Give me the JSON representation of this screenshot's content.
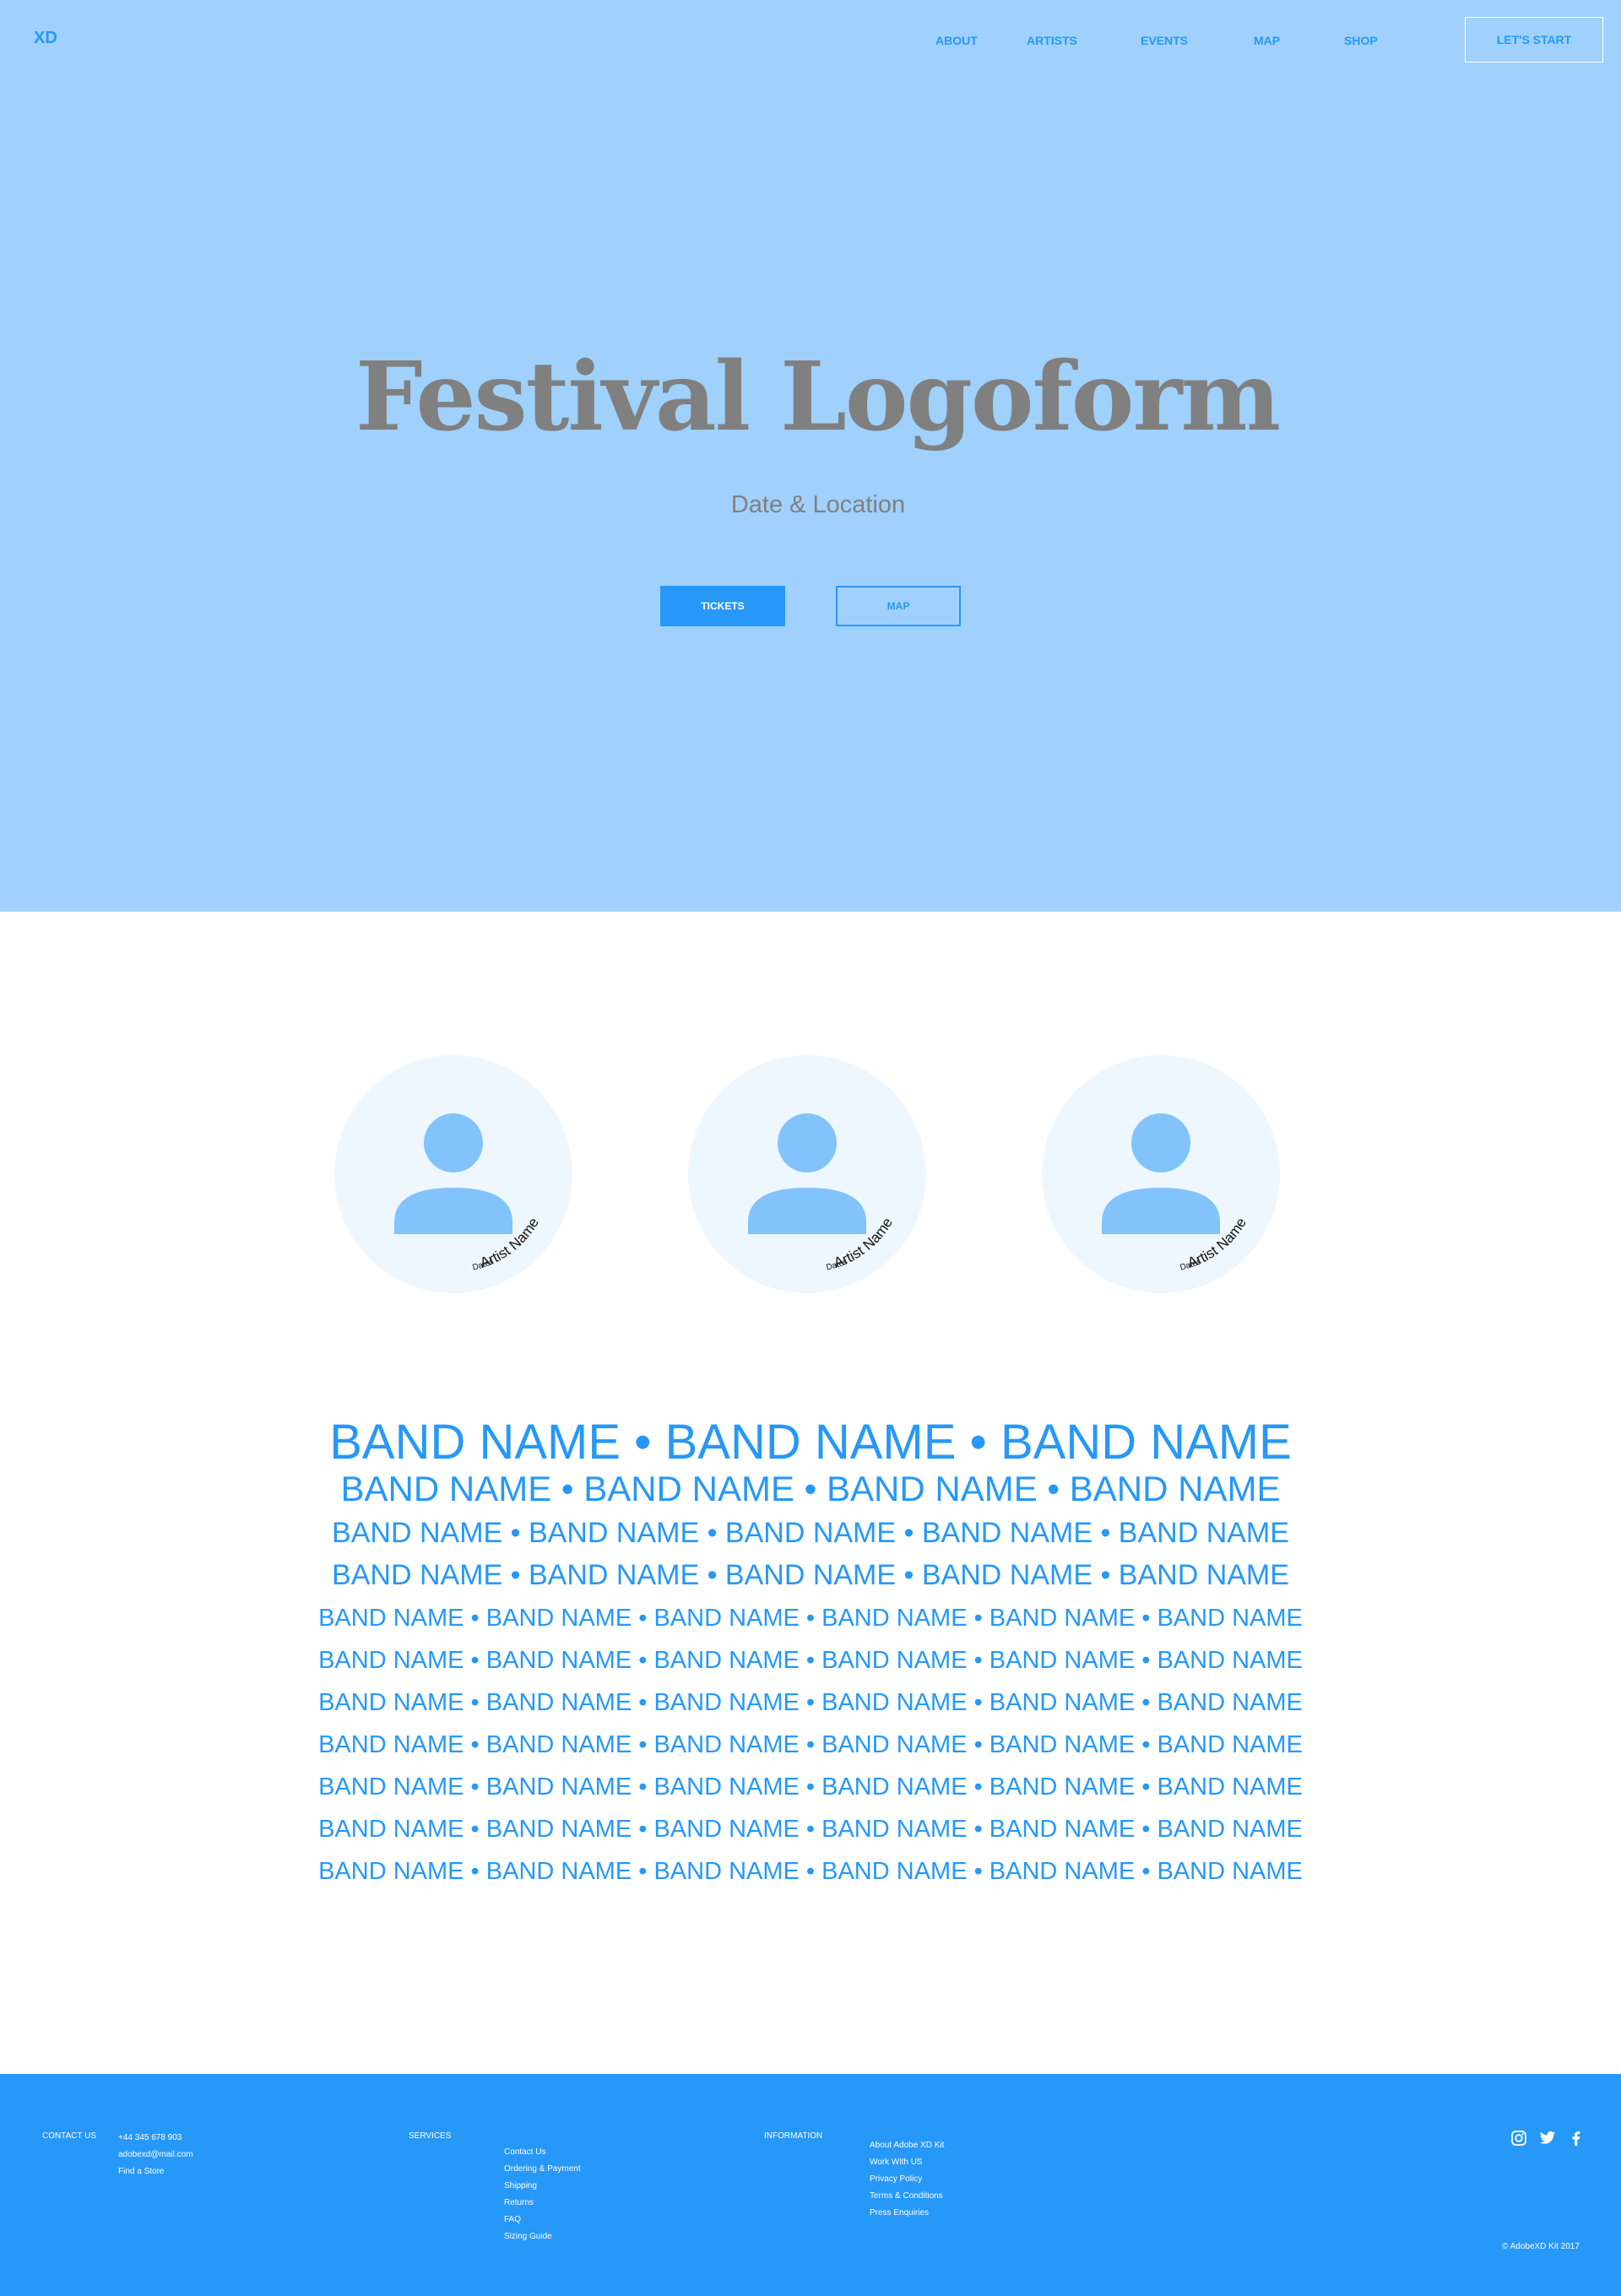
{
  "header": {
    "logo": "XD",
    "nav": [
      "ABOUT",
      "ARTISTS",
      "EVENTS",
      "MAP",
      "SHOP"
    ],
    "cta": "LET'S START"
  },
  "hero": {
    "title": "Festival Logoform",
    "subtitle": "Date & Location",
    "primary_button": "TICKETS",
    "secondary_button": "MAP"
  },
  "artists": [
    {
      "name": "Artist Name",
      "dates": "Dates"
    },
    {
      "name": "Artist Name",
      "dates": "Dates"
    },
    {
      "name": "Artist Name",
      "dates": "Dates"
    }
  ],
  "lineup": [
    "BAND NAME • BAND NAME • BAND NAME",
    "BAND NAME • BAND NAME • BAND NAME • BAND NAME",
    "BAND NAME • BAND NAME • BAND NAME • BAND NAME • BAND NAME",
    "BAND NAME • BAND NAME • BAND NAME • BAND NAME • BAND NAME",
    "BAND NAME • BAND NAME • BAND NAME • BAND NAME • BAND NAME • BAND NAME",
    "BAND NAME • BAND NAME • BAND NAME • BAND NAME • BAND NAME • BAND NAME",
    "BAND NAME • BAND NAME • BAND NAME • BAND NAME • BAND NAME • BAND NAME",
    "BAND NAME • BAND NAME • BAND NAME • BAND NAME • BAND NAME • BAND NAME",
    "BAND NAME • BAND NAME • BAND NAME • BAND NAME • BAND NAME • BAND NAME",
    "BAND NAME • BAND NAME • BAND NAME • BAND NAME • BAND NAME • BAND NAME",
    "BAND NAME • BAND NAME • BAND NAME • BAND NAME • BAND NAME • BAND NAME"
  ],
  "footer": {
    "contact": {
      "heading": "CONTACT US",
      "items": [
        "+44 345 678 903",
        "adobexd@mail.com",
        "Find a Store"
      ]
    },
    "services": {
      "heading": "SERVICES",
      "items": [
        "Contact Us",
        "Ordering & Payment",
        "Shipping",
        "Returns",
        "FAQ",
        "Sizing Guide"
      ]
    },
    "information": {
      "heading": "INFORMATION",
      "items": [
        "About Adobe XD Kit",
        "Work With US",
        "Privacy Policy",
        "Terms & Conditions",
        "Press Enquiries"
      ]
    },
    "social": [
      "instagram-icon",
      "twitter-icon",
      "facebook-icon"
    ],
    "copyright": "© AdobeXD Kit 2017"
  },
  "colors": {
    "hero_bg": "#9fd1fc",
    "accent": "#2698f8",
    "heading_gray": "#808080",
    "avatar_bg": "#eff7fe",
    "avatar_fg": "#82c3fc"
  }
}
